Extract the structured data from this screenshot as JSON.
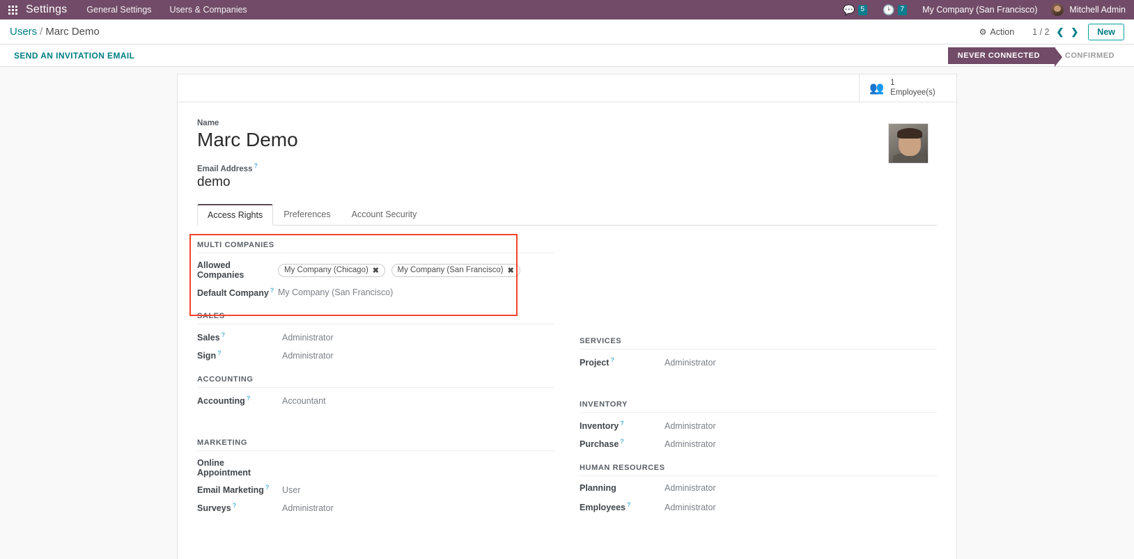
{
  "navbar": {
    "apps_icon": "apps-grid-icon",
    "brand": "Settings",
    "menus": [
      "General Settings",
      "Users & Companies"
    ],
    "messages_icon": "messages-icon",
    "messages_count": "5",
    "activities_icon": "clock-activity-icon",
    "activities_count": "7",
    "company": "My Company (San Francisco)",
    "user": "Mitchell Admin",
    "avatar": "user-avatar",
    "bg_color": "#714B67"
  },
  "control_panel": {
    "breadcrumb_root": "Users",
    "breadcrumb_sep": "/",
    "breadcrumb_current": "Marc Demo",
    "action_label": "Action",
    "gear_icon": "gear-icon",
    "pager": "1 / 2",
    "prev_icon": "chevron-left-icon",
    "next_icon": "chevron-right-icon",
    "new_label": "New",
    "accent": "#017e84"
  },
  "status_row": {
    "invite_label": "SEND AN INVITATION EMAIL",
    "statuses": [
      {
        "label": "NEVER CONNECTED",
        "active": true
      },
      {
        "label": "CONFIRMED",
        "active": false
      }
    ]
  },
  "smart_button": {
    "icon": "employees-group-icon",
    "count": "1",
    "label": "Employee(s)"
  },
  "record": {
    "name_label": "Name",
    "name_value": "Marc Demo",
    "email_label": "Email Address",
    "email_help": "?",
    "email_value": "demo",
    "avatar": "record-avatar-photo"
  },
  "tabs": [
    {
      "label": "Access Rights",
      "active": true
    },
    {
      "label": "Preferences",
      "active": false
    },
    {
      "label": "Account Security",
      "active": false
    }
  ],
  "multi_companies": {
    "title": "MULTI COMPANIES",
    "allowed_label": "Allowed Companies",
    "allowed_tags": [
      "My Company (Chicago)",
      "My Company (San Francisco)"
    ],
    "remove_icon": "remove-tag-icon",
    "default_label": "Default Company",
    "default_help": "?",
    "default_value": "My Company (San Francisco)",
    "highlight_color": "#f4422e"
  },
  "groups_left": [
    {
      "title": "SALES",
      "rows": [
        {
          "label": "Sales",
          "help": "?",
          "value": "Administrator"
        },
        {
          "label": "Sign",
          "help": "?",
          "value": "Administrator"
        }
      ]
    },
    {
      "title": "ACCOUNTING",
      "rows": [
        {
          "label": "Accounting",
          "help": "?",
          "value": "Accountant"
        }
      ]
    },
    {
      "title": "MARKETING",
      "rows": [
        {
          "label": "Online Appointment",
          "help": "",
          "value": ""
        },
        {
          "label": "Email Marketing",
          "help": "?",
          "value": "User"
        },
        {
          "label": "Surveys",
          "help": "?",
          "value": "Administrator"
        }
      ]
    }
  ],
  "groups_right": [
    {
      "title": "SERVICES",
      "rows": [
        {
          "label": "Project",
          "help": "?",
          "value": "Administrator"
        }
      ]
    },
    {
      "title": "INVENTORY",
      "rows": [
        {
          "label": "Inventory",
          "help": "?",
          "value": "Administrator"
        },
        {
          "label": "Purchase",
          "help": "?",
          "value": "Administrator"
        }
      ]
    },
    {
      "title": "HUMAN RESOURCES",
      "rows": [
        {
          "label": "Planning",
          "help": "",
          "value": "Administrator"
        },
        {
          "label": "Employees",
          "help": "?",
          "value": "Administrator"
        }
      ]
    }
  ]
}
